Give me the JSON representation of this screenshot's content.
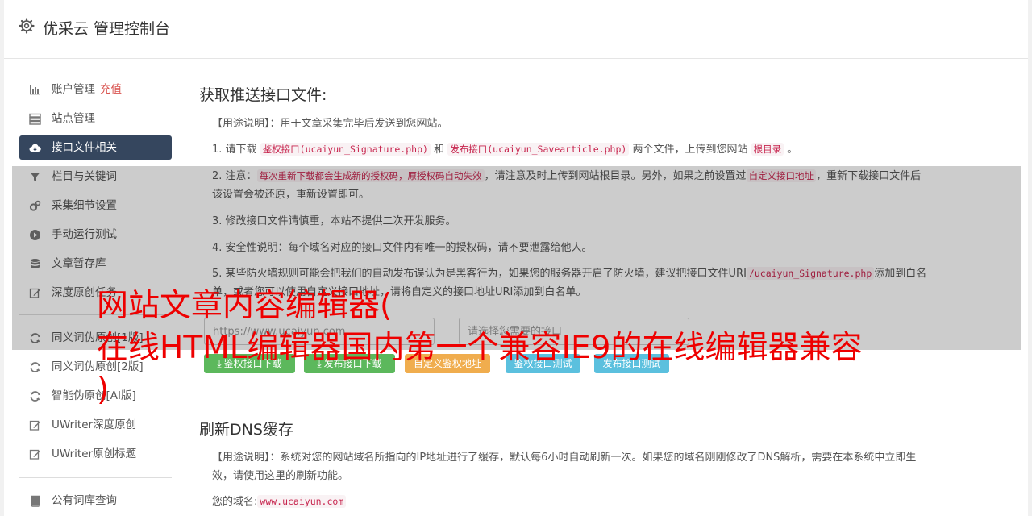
{
  "header": {
    "title": "优采云 管理控制台"
  },
  "sidebar": {
    "items": [
      {
        "label": "账户管理",
        "badge": "充值",
        "icon": "bar-chart-icon"
      },
      {
        "label": "站点管理",
        "icon": "server-icon"
      },
      {
        "label": "接口文件相关",
        "icon": "cloud-download-icon",
        "active": true
      },
      {
        "label": "栏目与关键词",
        "icon": "filter-icon"
      },
      {
        "label": "采集细节设置",
        "icon": "cogs-icon"
      },
      {
        "label": "手动运行测试",
        "icon": "play-circle-icon"
      },
      {
        "label": "文章暂存库",
        "icon": "database-icon"
      },
      {
        "label": "深度原创任务",
        "icon": "edit-icon"
      },
      {
        "label": "同义词伪原创[1版]",
        "icon": "refresh-icon"
      },
      {
        "label": "同义词伪原创[2版]",
        "icon": "refresh-icon"
      },
      {
        "label": "智能伪原创[AI版]",
        "icon": "refresh-icon"
      },
      {
        "label": "UWriter深度原创",
        "icon": "edit-icon"
      },
      {
        "label": "UWriter原创标题",
        "icon": "edit-icon"
      },
      {
        "label": "公有词库查询",
        "icon": "book-icon"
      }
    ]
  },
  "section1": {
    "title": "获取推送接口文件:",
    "usage": "【用途说明】：用于文章采集完毕后发送到您网站。",
    "item1": {
      "a": "1. 请下载",
      "code1": "鉴权接口(ucaiyun_Signature.php)",
      "b": "和",
      "code2": "发布接口(ucaiyun_Savearticle.php)",
      "c": "两个文件，上传到您网站",
      "code3": "根目录",
      "d": "。"
    },
    "item2": {
      "a": "2. 注意：",
      "code1": "每次重新下载都会生成新的授权码，原授权码自动失效",
      "b": "，请注意及时上传到网站根目录。另外，如果之前设置过",
      "code2": "自定义接口地址",
      "c": "，重新下载接口文件后该设置会被还原，重新设置即可。"
    },
    "item3": "3. 修改接口文件请慎重，本站不提供二次开发服务。",
    "item4": "4. 安全性说明：每个域名对应的接口文件内有唯一的授权码，请不要泄露给他人。",
    "item5": {
      "a": "5. 某些防火墙规则可能会把我们的自动发布误认为是黑客行为，如果您的服务器开启了防火墙，建议把接口文件URI",
      "code1": "/ucaiyun_Signature.php",
      "b": "添加到白名单，或者您可以使用自定义接口地址，请将自定义的接口地址URI添加到白名单。"
    },
    "site_select": "https://www.ucaiyun.com",
    "iface_select": "请选择您需要的接口",
    "buttons": {
      "download_auth": "鉴权接口下载",
      "download_publish": "发布接口下载",
      "custom_auth": "自定义鉴权地址",
      "test_auth": "鉴权接口测试",
      "test_publish": "发布接口测试"
    }
  },
  "section2": {
    "title": "刷新DNS缓存",
    "usage": "【用途说明】：系统对您的网站域名所指向的IP地址进行了缓存，默认每6小时自动刷新一次。如果您的域名刚刚修改了DNS解析，需要在本系统中立即生效，请使用这里的刷新功能。",
    "domain_label": "您的域名:",
    "domain_value": "www.ucaiyun.com"
  },
  "overlay": {
    "line1": "网站文章内容编辑器(",
    "line2": "在线HTML编辑器国内第一个兼容IE9的在线编辑器兼容",
    "line3": ")"
  },
  "colors": {
    "accent": "#35465e",
    "success": "#5cb85c",
    "warning": "#f0ad4e",
    "info": "#5bc0de",
    "danger": "#d9534f",
    "overlay_text": "#ee0000"
  }
}
